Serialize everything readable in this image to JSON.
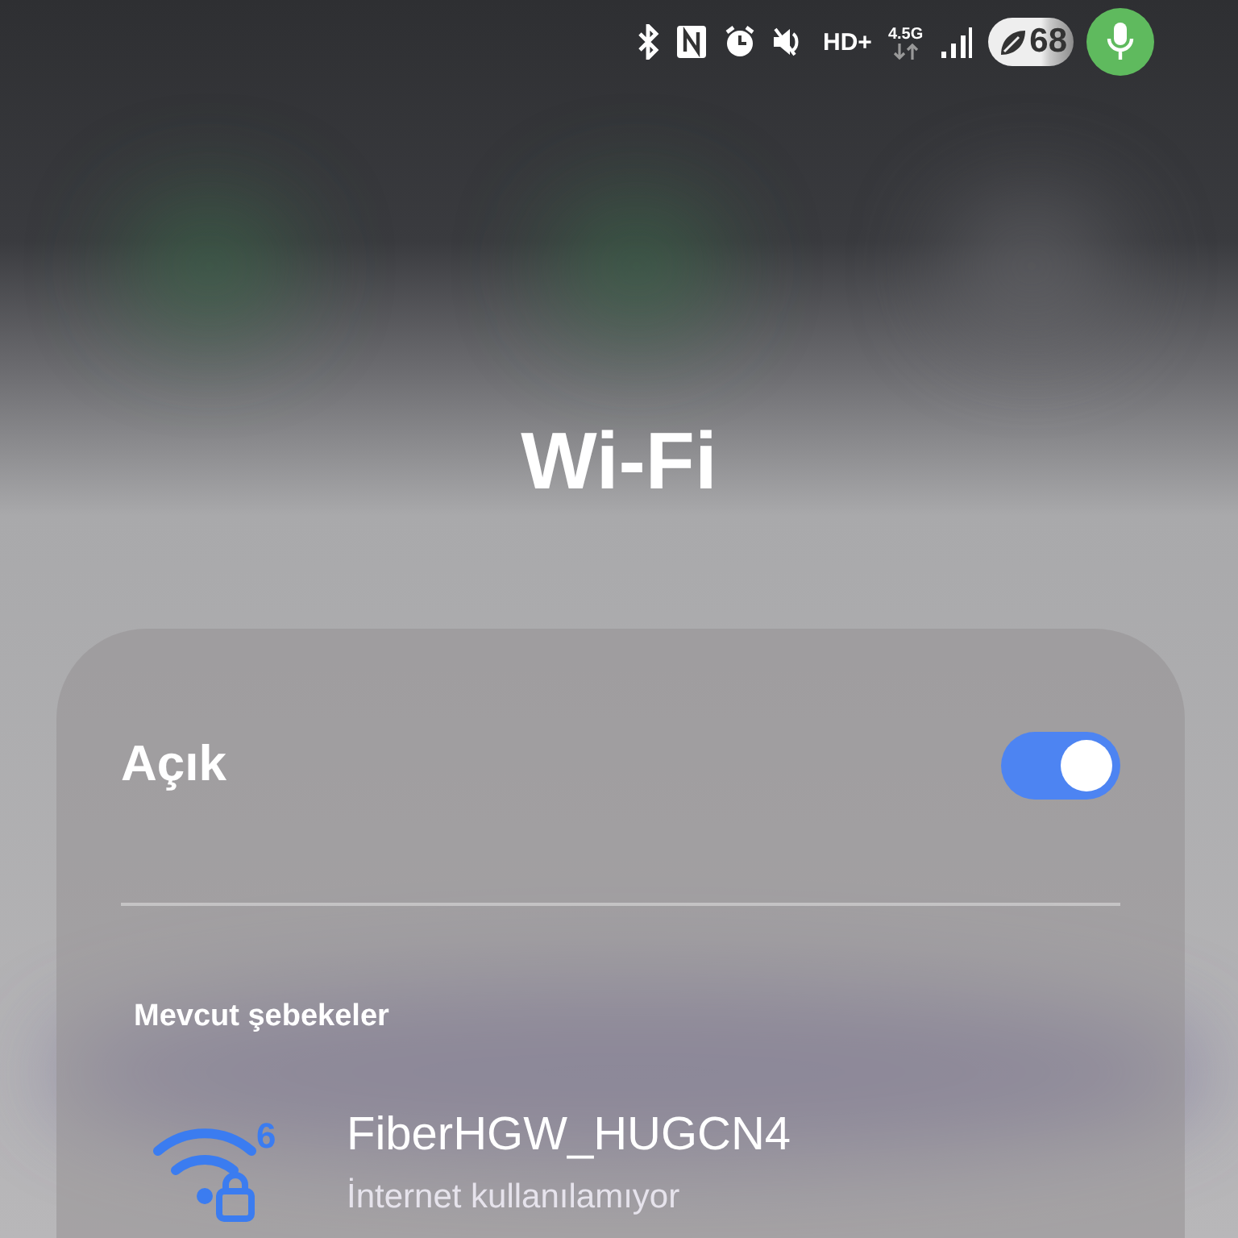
{
  "status_bar": {
    "hd_label": "HD+",
    "network_type": "4.5G",
    "battery": "68",
    "mic_active": true
  },
  "title": "Wi-Fi",
  "wifi_toggle": {
    "label": "Açık",
    "on": true
  },
  "section_title": "Mevcut şebekeler",
  "networks": [
    {
      "name": "FiberHGW_HUGCN4",
      "status": "İnternet kullanılamıyor",
      "standard": "6",
      "locked": true
    }
  ]
}
